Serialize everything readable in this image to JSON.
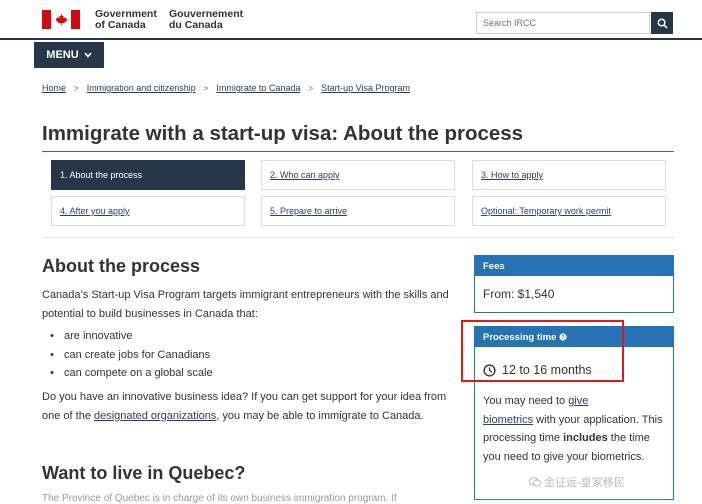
{
  "header": {
    "signature_en_1": "Government",
    "signature_en_2": "of Canada",
    "signature_fr_1": "Gouvernement",
    "signature_fr_2": "du Canada",
    "search_placeholder": "Search IRCC"
  },
  "menu": {
    "label": "MENU"
  },
  "breadcrumb": [
    "Home",
    "Immigration and citizenship",
    "Immigrate to Canada",
    "Start-up Visa Program"
  ],
  "page_title": "Immigrate with a start-up visa: About the process",
  "steps": [
    {
      "label": "1. About the process",
      "active": true
    },
    {
      "label": "2. Who can apply",
      "active": false
    },
    {
      "label": "3. How to apply",
      "active": false
    },
    {
      "label": "4. After you apply",
      "active": false
    },
    {
      "label": "5. Prepare to arrive",
      "active": false
    },
    {
      "label": "Optional: Temporary work permit",
      "active": false
    }
  ],
  "about": {
    "heading": "About the process",
    "intro": "Canada’s Start-up Visa Program targets immigrant entrepreneurs with the skills and potential to build businesses in Canada that:",
    "bullets": [
      "are innovative",
      "can create jobs for Canadians",
      "can compete on a global scale"
    ],
    "idea_before": "Do you have an innovative business idea? If you can get support for your idea from one of the ",
    "idea_link": "designated organizations",
    "idea_after": ", you may be able to immigrate to Canada."
  },
  "quebec": {
    "heading": "Want to live in Quebec?",
    "partial_text": "The Province of Quebec is in charge of its own business immigration program. If"
  },
  "fees": {
    "label": "Fees",
    "value": "From: $1,540"
  },
  "processing": {
    "label": "Processing time",
    "value": "12 to 16 months",
    "text_before": "You may need to ",
    "text_link_1": "give",
    "text_link_2": "biometrics",
    "text_mid": " with your application. This processing time ",
    "text_bold": "includes",
    "text_after": " the time you need to give your biometrics."
  },
  "watermark": "金征远-皇家移民",
  "colors": {
    "navy": "#26374a",
    "panel_blue": "#2572b4",
    "link": "#284162",
    "flag_red": "#d3080c",
    "highlight_red": "#e0191b"
  }
}
